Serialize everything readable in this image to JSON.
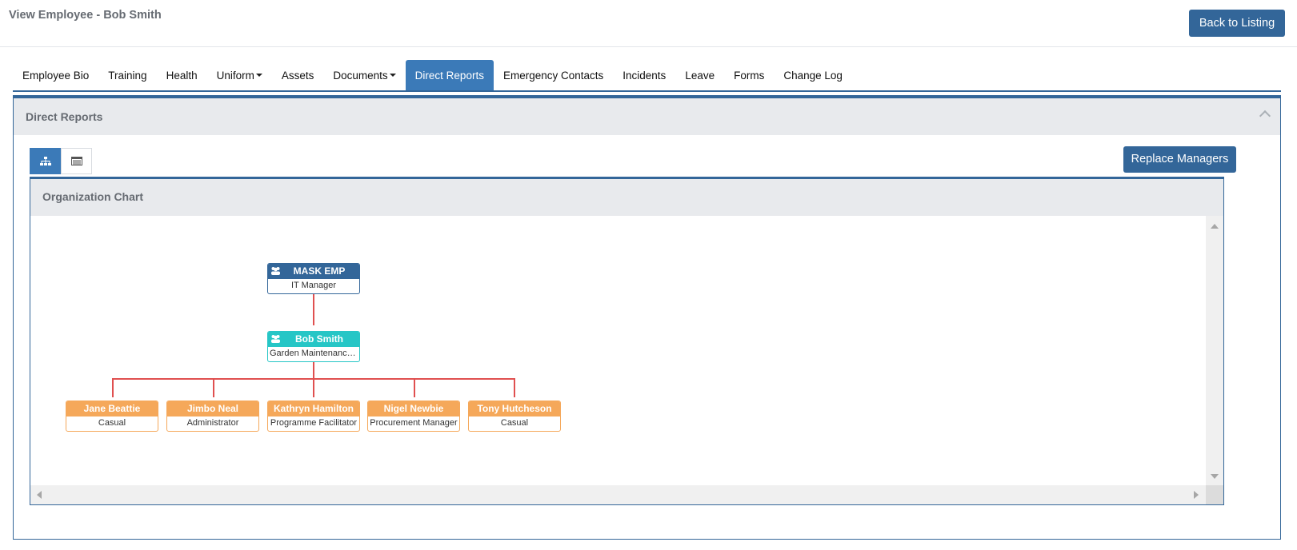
{
  "page": {
    "title": "View Employee - Bob Smith",
    "back_label": "Back to Listing"
  },
  "tabs": [
    {
      "label": "Employee Bio"
    },
    {
      "label": "Training"
    },
    {
      "label": "Health"
    },
    {
      "label": "Uniform"
    },
    {
      "label": "Assets"
    },
    {
      "label": "Documents"
    },
    {
      "label": "Direct Reports",
      "active": true
    },
    {
      "label": "Emergency Contacts"
    },
    {
      "label": "Incidents"
    },
    {
      "label": "Leave"
    },
    {
      "label": "Forms"
    },
    {
      "label": "Change Log"
    }
  ],
  "panel": {
    "title": "Direct Reports",
    "replace_label": "Replace Managers"
  },
  "view_toggle": {
    "active": "org-chart-icon",
    "other": "table-icon"
  },
  "chart": {
    "title": "Organization Chart",
    "manager": {
      "name": "MASK EMP",
      "title": "IT Manager"
    },
    "employee": {
      "name": "Bob Smith",
      "title": "Garden Maintenance..."
    },
    "reports": [
      {
        "name": "Jane Beattie",
        "title": "Casual"
      },
      {
        "name": "Jimbo Neal",
        "title": "Administrator"
      },
      {
        "name": "Kathryn Hamilton",
        "title": "Programme Facilitator"
      },
      {
        "name": "Nigel Newbie",
        "title": "Procurement Manager"
      },
      {
        "name": "Tony Hutcheson",
        "title": "Casual"
      }
    ]
  },
  "colors": {
    "primary": "#336699",
    "active_tab": "#3b7ab8",
    "teal": "#26c6c6",
    "orange": "#f5a85a",
    "connector": "#e05050"
  }
}
